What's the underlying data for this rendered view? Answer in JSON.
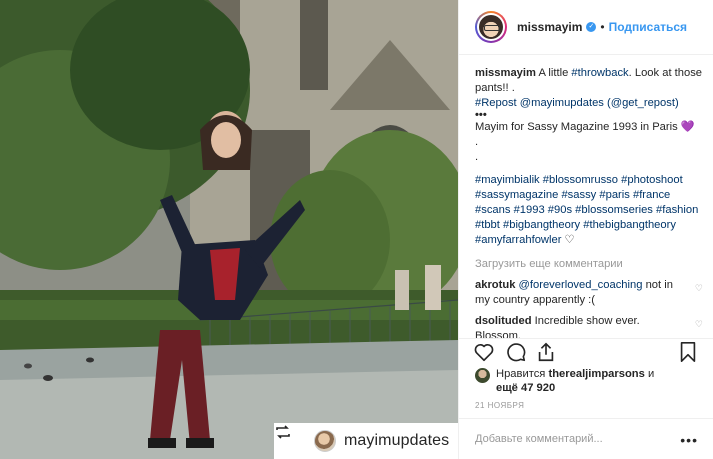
{
  "header": {
    "username": "missmayim",
    "verified_icon": "verified-badge-icon",
    "separator": "•",
    "follow_label": "Подписаться"
  },
  "caption": {
    "username": "missmayim",
    "text": "A little",
    "hashtag1": "#throwback",
    "text2": ". Look at those pants!! .",
    "repost_tag": "#Repost",
    "mention1": "@mayimupdates",
    "mention2_text": "(@get_repost)",
    "bullets": "•••",
    "line2": "Mayim for Sassy Magazine 1993 in Paris",
    "heart": "💜",
    "dot1": ".",
    "dot2": ".",
    "hashtags": [
      "#mayimbialik",
      "#blossomrusso",
      "#photoshoot",
      "#sassymagazine",
      "#sassy",
      "#paris",
      "#france",
      "#scans",
      "#1993",
      "#90s",
      "#blossomseries",
      "#fashion",
      "#tbbt",
      "#bigbangtheory",
      "#thebigbangtheory",
      "#amyfarrahfowler"
    ],
    "trail_heart": "♡"
  },
  "load_more": "Загрузить еще комментарии",
  "comments": [
    {
      "user": "akrotuk",
      "mention": "@foreverloved_coaching",
      "text": "not in my country apparently :("
    },
    {
      "user": "dsolituded",
      "mention": "",
      "text": "Incredible show ever. Blossom."
    }
  ],
  "likes": {
    "prefix": "Нравится",
    "user": "therealjimparsons",
    "mid": "и",
    "more": "ещё 47 920"
  },
  "date": "21 НОЯБРЯ",
  "add_comment": {
    "placeholder": "Добавьте комментарий..."
  },
  "more_options": "•••",
  "repost_overlay": {
    "username": "mayimupdates",
    "icon": "repost-icon"
  },
  "actions": [
    "like-icon",
    "comment-icon",
    "share-icon",
    "bookmark-icon"
  ]
}
